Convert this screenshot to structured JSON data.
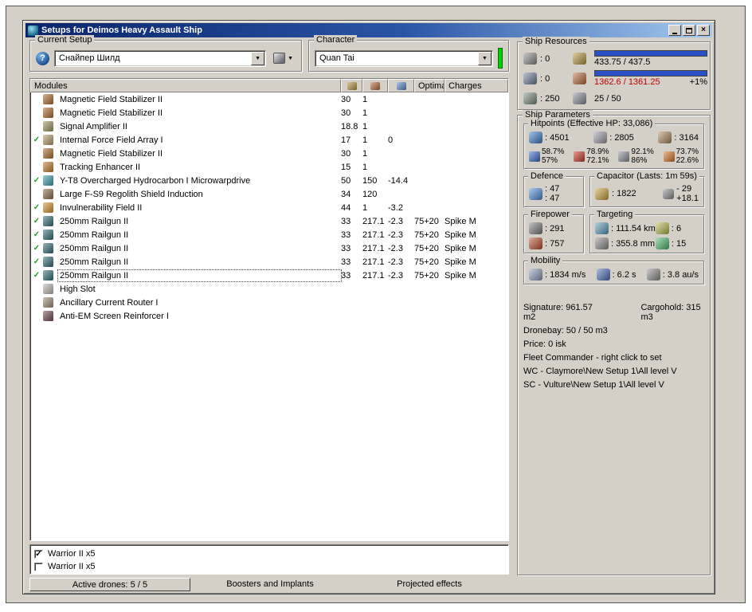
{
  "icons": {
    "check": "✓",
    "dropdown": "▼",
    "close": "×",
    "question": "?"
  },
  "colors": {
    "titlebar_accent": "#0a246a",
    "over_limit_text": "#c00000",
    "fitted_check": "#1fa01f",
    "resource_bar": "#2a50c8",
    "character_status": "#00cc00"
  },
  "window": {
    "title": "Setups for Deimos Heavy Assault Ship"
  },
  "current_setup": {
    "group_label": "Current Setup",
    "selected_value": "Снайпер Шилд"
  },
  "character": {
    "group_label": "Character",
    "selected_value": "Quan Tai"
  },
  "ship_resources": {
    "group_label": "Ship Resources",
    "turrets": ": 0",
    "launchers": ": 0",
    "drones": ": 250",
    "cpu_value": "433.75 / 437.5",
    "powergrid_value": "1362.6 / 1361.25",
    "powergrid_over": "+1%",
    "calibration_value": "25 / 50"
  },
  "modules": {
    "header_name": "Modules",
    "header_optimal": "Optimal",
    "header_charges": "Charges",
    "rows": [
      {
        "check": false,
        "selected": false,
        "icon": "magnetic-field-stabilizer-icon",
        "color": "#a8682a",
        "name": "Magnetic Field Stabilizer II",
        "cpu": "30",
        "grid": "1",
        "cap": "",
        "optimal": "",
        "charges": ""
      },
      {
        "check": false,
        "selected": false,
        "icon": "magnetic-field-stabilizer-icon",
        "color": "#a8682a",
        "name": "Magnetic Field Stabilizer II",
        "cpu": "30",
        "grid": "1",
        "cap": "",
        "optimal": "",
        "charges": ""
      },
      {
        "check": false,
        "selected": false,
        "icon": "signal-amplifier-icon",
        "color": "#98905a",
        "name": "Signal Amplifier II",
        "cpu": "18.8",
        "grid": "1",
        "cap": "",
        "optimal": "",
        "charges": ""
      },
      {
        "check": true,
        "selected": false,
        "icon": "internal-force-field-array-icon",
        "color": "#b09a66",
        "name": "Internal Force Field Array I",
        "cpu": "17",
        "grid": "1",
        "cap": "0",
        "optimal": "",
        "charges": ""
      },
      {
        "check": false,
        "selected": false,
        "icon": "magnetic-field-stabilizer-icon",
        "color": "#a8682a",
        "name": "Magnetic Field Stabilizer II",
        "cpu": "30",
        "grid": "1",
        "cap": "",
        "optimal": "",
        "charges": ""
      },
      {
        "check": false,
        "selected": false,
        "icon": "tracking-enhancer-icon",
        "color": "#c07a2a",
        "name": "Tracking Enhancer II",
        "cpu": "15",
        "grid": "1",
        "cap": "",
        "optimal": "",
        "charges": ""
      },
      {
        "check": true,
        "selected": false,
        "icon": "microwarpdrive-icon",
        "color": "#3a9aa8",
        "name": "Y-T8 Overcharged Hydrocarbon I Microwarpdrive",
        "cpu": "50",
        "grid": "150",
        "cap": "-14.4",
        "optimal": "",
        "charges": ""
      },
      {
        "check": false,
        "selected": false,
        "icon": "shield-rig-icon",
        "color": "#8a6848",
        "name": "Large F-S9 Regolith Shield Induction",
        "cpu": "34",
        "grid": "120",
        "cap": "",
        "optimal": "",
        "charges": ""
      },
      {
        "check": true,
        "selected": false,
        "icon": "invulnerability-field-icon",
        "color": "#d0922a",
        "name": "Invulnerability Field II",
        "cpu": "44",
        "grid": "1",
        "cap": "-3.2",
        "optimal": "",
        "charges": ""
      },
      {
        "check": true,
        "selected": false,
        "icon": "railgun-icon",
        "color": "#2e6a72",
        "name": "250mm Railgun II",
        "cpu": "33",
        "grid": "217.1",
        "cap": "-2.3",
        "optimal": "75+20",
        "charges": "Spike M"
      },
      {
        "check": true,
        "selected": false,
        "icon": "railgun-icon",
        "color": "#2e6a72",
        "name": "250mm Railgun II",
        "cpu": "33",
        "grid": "217.1",
        "cap": "-2.3",
        "optimal": "75+20",
        "charges": "Spike M"
      },
      {
        "check": true,
        "selected": false,
        "icon": "railgun-icon",
        "color": "#2e6a72",
        "name": "250mm Railgun II",
        "cpu": "33",
        "grid": "217.1",
        "cap": "-2.3",
        "optimal": "75+20",
        "charges": "Spike M"
      },
      {
        "check": true,
        "selected": false,
        "icon": "railgun-icon",
        "color": "#2e6a72",
        "name": "250mm Railgun II",
        "cpu": "33",
        "grid": "217.1",
        "cap": "-2.3",
        "optimal": "75+20",
        "charges": "Spike M"
      },
      {
        "check": true,
        "selected": true,
        "icon": "railgun-icon",
        "color": "#2e6a72",
        "name": "250mm Railgun II",
        "cpu": "33",
        "grid": "217.1",
        "cap": "-2.3",
        "optimal": "75+20",
        "charges": "Spike M"
      },
      {
        "check": false,
        "selected": false,
        "icon": "empty-high-slot-icon",
        "color": "#b8b4ac",
        "name": "High Slot",
        "cpu": "",
        "grid": "",
        "cap": "",
        "optimal": "",
        "charges": ""
      },
      {
        "check": false,
        "selected": false,
        "icon": "ancillary-current-router-icon",
        "color": "#9a8a72",
        "name": "Ancillary Current Router I",
        "cpu": "",
        "grid": "",
        "cap": "",
        "optimal": "",
        "charges": ""
      },
      {
        "check": false,
        "selected": false,
        "icon": "anti-em-screen-reinforcer-icon",
        "color": "#70454e",
        "name": "Anti-EM Screen Reinforcer I",
        "cpu": "",
        "grid": "",
        "cap": "",
        "optimal": "",
        "charges": ""
      }
    ]
  },
  "drones": {
    "items": [
      {
        "checked": true,
        "label": "Warrior II x5"
      },
      {
        "checked": false,
        "label": "Warrior II x5"
      }
    ]
  },
  "tabs": [
    {
      "label": "Active drones: 5 / 5",
      "active": true
    },
    {
      "label": "Boosters and Implants",
      "active": false
    },
    {
      "label": "Projected effects",
      "active": false
    }
  ],
  "ship_parameters": {
    "group_label": "Ship Parameters",
    "hitpoints": {
      "label": "Hitpoints (Effective HP: 33,086)",
      "shield": ": 4501",
      "armor": ": 2805",
      "structure": ": 3164",
      "resists": [
        {
          "shield": "58.7%",
          "armor": "57%"
        },
        {
          "shield": "78.9%",
          "armor": "72.1%"
        },
        {
          "shield": "92.1%",
          "armor": "86%"
        },
        {
          "shield": "73.7%",
          "armor": "22.6%"
        }
      ]
    },
    "defence": {
      "label": "Defence",
      "value1": ": 47",
      "value2": ": 47"
    },
    "capacitor": {
      "label": "Capacitor (Lasts: 1m 59s)",
      "amount": ": 1822",
      "usage": "- 29",
      "recharge": "+18.1"
    },
    "firepower": {
      "label": "Firepower",
      "volley": ": 291",
      "dps": ": 757"
    },
    "targeting": {
      "label": "Targeting",
      "range": ": 111.54 km",
      "max_targets": ": 6",
      "scan_resolution": ": 355.8 mm",
      "sensor_strength": ": 15"
    },
    "mobility": {
      "label": "Mobility",
      "max_velocity": ": 1834 m/s",
      "align_time": ": 6.2 s",
      "warp_speed": ": 3.8 au/s"
    },
    "info": {
      "signature": "Signature: 961.57 m2",
      "cargohold": "Cargohold: 315 m3",
      "lines": [
        "Dronebay: 50 / 50 m3",
        "Price: 0 isk",
        "Fleet Commander - right click to set",
        "WC - Claymore\\New Setup 1\\All level V",
        "SC - Vulture\\New Setup 1\\All level V"
      ]
    }
  }
}
